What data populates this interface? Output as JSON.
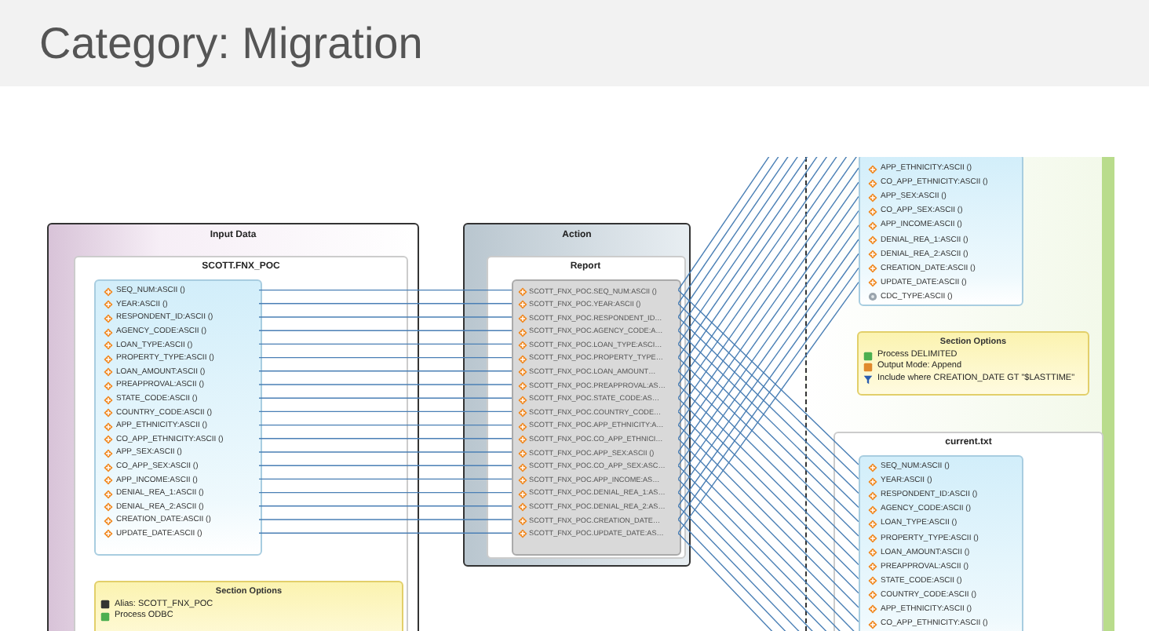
{
  "page_title": "Category: Migration",
  "diagram": {
    "input_panel": {
      "title": "Input Data",
      "table": {
        "title": "SCOTT.FNX_POC",
        "fields": [
          "SEQ_NUM:ASCII ()",
          "YEAR:ASCII ()",
          "RESPONDENT_ID:ASCII ()",
          "AGENCY_CODE:ASCII ()",
          "LOAN_TYPE:ASCII ()",
          "PROPERTY_TYPE:ASCII ()",
          "LOAN_AMOUNT:ASCII ()",
          "PREAPPROVAL:ASCII ()",
          "STATE_CODE:ASCII ()",
          "COUNTRY_CODE:ASCII ()",
          "APP_ETHNICITY:ASCII ()",
          "CO_APP_ETHNICITY:ASCII ()",
          "APP_SEX:ASCII ()",
          "CO_APP_SEX:ASCII ()",
          "APP_INCOME:ASCII ()",
          "DENIAL_REA_1:ASCII ()",
          "DENIAL_REA_2:ASCII ()",
          "CREATION_DATE:ASCII ()",
          "UPDATE_DATE:ASCII ()"
        ]
      },
      "section_options": {
        "title": "Section Options",
        "items": [
          {
            "kind": "alias",
            "text": "Alias: SCOTT_FNX_POC"
          },
          {
            "kind": "process",
            "text": "Process ODBC"
          }
        ]
      }
    },
    "action_panel": {
      "title": "Action",
      "report": {
        "title": "Report",
        "fields": [
          "SCOTT_FNX_POC.SEQ_NUM:ASCII ()",
          "SCOTT_FNX_POC.YEAR:ASCII ()",
          "SCOTT_FNX_POC.RESPONDENT_ID…",
          "SCOTT_FNX_POC.AGENCY_CODE:A…",
          "SCOTT_FNX_POC.LOAN_TYPE:ASCI…",
          "SCOTT_FNX_POC.PROPERTY_TYPE…",
          "SCOTT_FNX_POC.LOAN_AMOUNT…",
          "SCOTT_FNX_POC.PREAPPROVAL:AS…",
          "SCOTT_FNX_POC.STATE_CODE:AS…",
          "SCOTT_FNX_POC.COUNTRY_CODE…",
          "SCOTT_FNX_POC.APP_ETHNICITY:A…",
          "SCOTT_FNX_POC.CO_APP_ETHNICI…",
          "SCOTT_FNX_POC.APP_SEX:ASCII ()",
          "SCOTT_FNX_POC.CO_APP_SEX:ASC…",
          "SCOTT_FNX_POC.APP_INCOME:AS…",
          "SCOTT_FNX_POC.DENIAL_REA_1:AS…",
          "SCOTT_FNX_POC.DENIAL_REA_2:AS…",
          "SCOTT_FNX_POC.CREATION_DATE…",
          "SCOTT_FNX_POC.UPDATE_DATE:AS…"
        ]
      }
    },
    "output_panel": {
      "upper_fields": [
        {
          "kind": "field",
          "text": "APP_ETHNICITY:ASCII ()"
        },
        {
          "kind": "field",
          "text": "CO_APP_ETHNICITY:ASCII ()"
        },
        {
          "kind": "field",
          "text": "APP_SEX:ASCII ()"
        },
        {
          "kind": "field",
          "text": "CO_APP_SEX:ASCII ()"
        },
        {
          "kind": "field",
          "text": "APP_INCOME:ASCII ()"
        },
        {
          "kind": "field",
          "text": "DENIAL_REA_1:ASCII ()"
        },
        {
          "kind": "field",
          "text": "DENIAL_REA_2:ASCII ()"
        },
        {
          "kind": "field",
          "text": "CREATION_DATE:ASCII ()"
        },
        {
          "kind": "field",
          "text": "UPDATE_DATE:ASCII ()"
        },
        {
          "kind": "generated",
          "text": "CDC_TYPE:ASCII ()"
        }
      ],
      "section_options": {
        "title": "Section Options",
        "items": [
          {
            "kind": "process",
            "text": "Process DELIMITED"
          },
          {
            "kind": "output_mode",
            "text": "Output Mode: Append"
          },
          {
            "kind": "filter",
            "text": "Include where CREATION_DATE GT \"$LASTTIME\""
          }
        ]
      },
      "file": {
        "title": "current.txt",
        "fields": [
          "SEQ_NUM:ASCII ()",
          "YEAR:ASCII ()",
          "RESPONDENT_ID:ASCII ()",
          "AGENCY_CODE:ASCII ()",
          "LOAN_TYPE:ASCII ()",
          "PROPERTY_TYPE:ASCII ()",
          "LOAN_AMOUNT:ASCII ()",
          "PREAPPROVAL:ASCII ()",
          "STATE_CODE:ASCII ()",
          "COUNTRY_CODE:ASCII ()",
          "APP_ETHNICITY:ASCII ()",
          "CO_APP_ETHNICITY:ASCII ()"
        ]
      }
    }
  }
}
